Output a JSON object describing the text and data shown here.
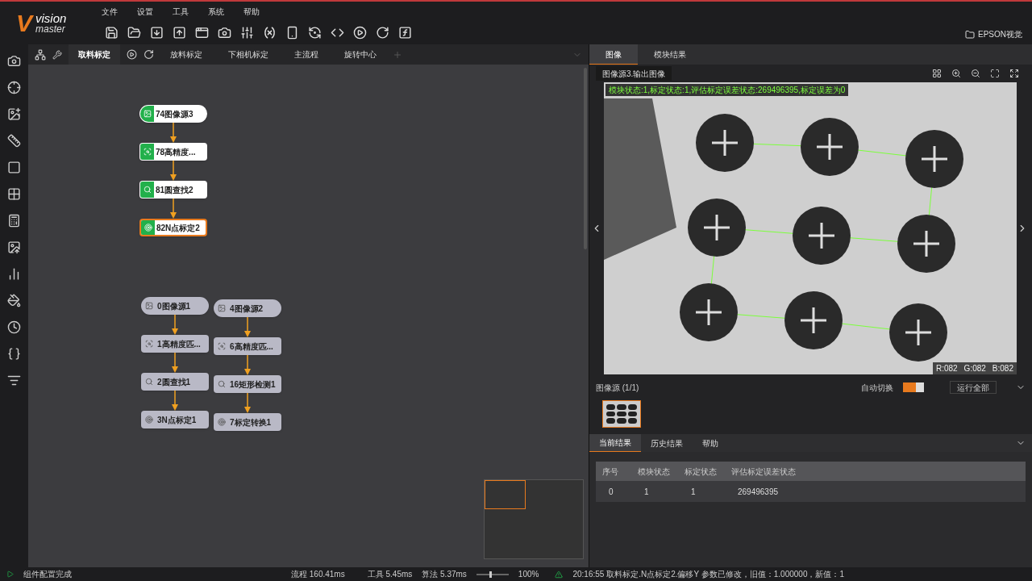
{
  "app": {
    "logo_mark": "V",
    "logo_title": "vision",
    "logo_subtitle": "master"
  },
  "menu": [
    "文件",
    "设置",
    "工具",
    "系统",
    "帮助"
  ],
  "solution": {
    "label": "EPSON视觉"
  },
  "flow_tabs": [
    {
      "label": "取料标定",
      "selected": true
    },
    {
      "label": "放料标定",
      "selected": false
    },
    {
      "label": "下相机标定",
      "selected": false
    },
    {
      "label": "主流程",
      "selected": false
    },
    {
      "label": "旋转中心",
      "selected": false
    }
  ],
  "flow_groups": [
    {
      "active": true,
      "nodes": [
        {
          "label": "74图像源3",
          "kind": "source",
          "selected": false
        },
        {
          "label": "78高精度...",
          "kind": "match",
          "selected": false
        },
        {
          "label": "81圆查找2",
          "kind": "find",
          "selected": false
        },
        {
          "label": "82N点标定2",
          "kind": "calib",
          "selected": true
        }
      ]
    },
    {
      "active": false,
      "nodes": [
        {
          "label": "0图像源1",
          "kind": "source",
          "selected": false
        },
        {
          "label": "1高精度匹...",
          "kind": "match",
          "selected": false
        },
        {
          "label": "2圆查找1",
          "kind": "find",
          "selected": false
        },
        {
          "label": "3N点标定1",
          "kind": "calib",
          "selected": false
        }
      ]
    },
    {
      "active": false,
      "nodes": [
        {
          "label": "4图像源2",
          "kind": "source",
          "selected": false
        },
        {
          "label": "6高精度匹...",
          "kind": "match",
          "selected": false
        },
        {
          "label": "16矩形检测1",
          "kind": "find",
          "selected": false
        },
        {
          "label": "7标定转换1",
          "kind": "calib",
          "selected": false
        }
      ]
    }
  ],
  "image_view": {
    "tabs": [
      {
        "label": "图像",
        "selected": true
      },
      {
        "label": "模块结果",
        "selected": false
      }
    ],
    "source_select": "图像源3.输出图像",
    "overlay_text": "模块状态:1,标定状态:1,评估标定误差状态:269496395,标定误差为0",
    "pixel_info": [
      "R:082",
      "G:082",
      "B:082"
    ]
  },
  "image_source": {
    "title": "图像源 (1/1)",
    "auto_switch_label": "自动切换",
    "auto_switch_on": true,
    "run_button": "运行全部"
  },
  "result_tabs": [
    {
      "label": "当前结果",
      "selected": true
    },
    {
      "label": "历史结果",
      "selected": false
    },
    {
      "label": "帮助",
      "selected": false
    }
  ],
  "result_table": {
    "columns": [
      "序号",
      "模块状态",
      "标定状态",
      "评估标定误差状态"
    ],
    "rows": [
      [
        "0",
        "1",
        "1",
        "269496395"
      ]
    ]
  },
  "status": {
    "message": "组件配置完成",
    "process_time": "流程 160.41ms",
    "tool_time": "工具 5.45ms",
    "algo_time": "算法 5.37ms",
    "zoom_slider": {
      "level": 0.4
    },
    "zoom": "100%",
    "log": "20:16:55 取料标定.N点标定2.偏移Y 参数已修改，旧值：1.000000，新值：1"
  }
}
